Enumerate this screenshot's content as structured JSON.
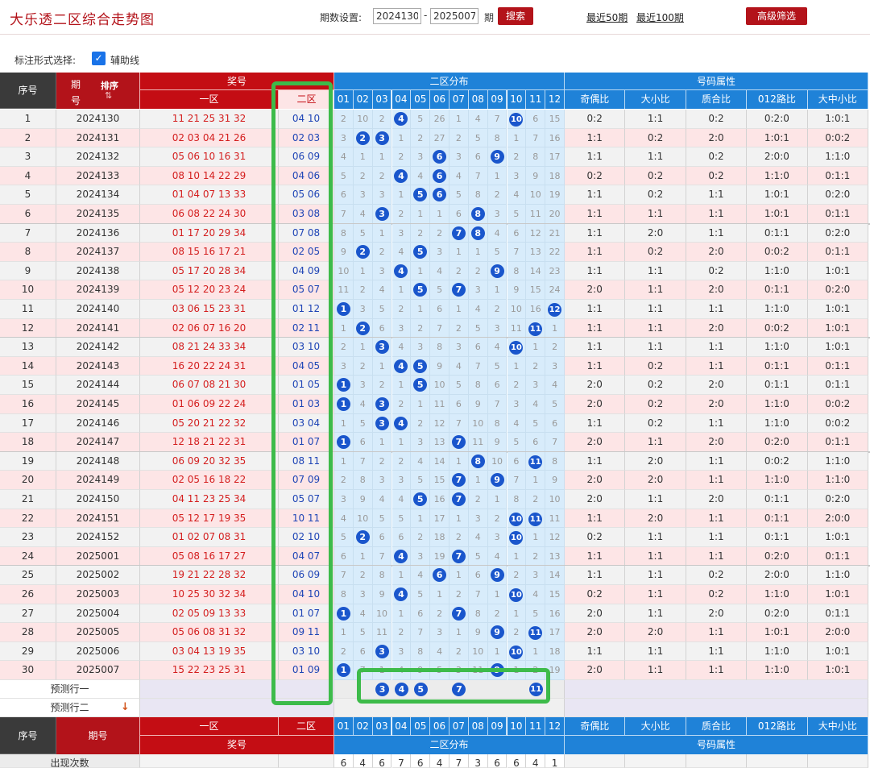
{
  "header": {
    "title": "大乐透二区综合走势图",
    "period_label": "期数设置:",
    "period_start": "2024130",
    "period_end": "2025007",
    "period_unit": "期",
    "search_label": "搜索",
    "recent50_label": "最近50期",
    "recent100_label": "最近100期",
    "advanced_label": "高级筛选"
  },
  "marking": {
    "label": "标注形式选择:",
    "guide_label": "辅助线"
  },
  "table_header": {
    "seq": "序号",
    "issue_top": "期",
    "issue_bottom": "号",
    "sort": "排序",
    "award": "奖号",
    "zone1": "一区",
    "zone2": "二区",
    "dist": "二区分布",
    "attr": "号码属性",
    "attr_cols": [
      "奇偶比",
      "大小比",
      "质合比",
      "012路比",
      "大中小比"
    ],
    "nums": [
      "01",
      "02",
      "03",
      "04",
      "05",
      "06",
      "07",
      "08",
      "09",
      "10",
      "11",
      "12"
    ]
  },
  "rows": [
    {
      "seq": "1",
      "issue": "2024130",
      "front": "11 21 25 31 32",
      "back": "04 10",
      "dist": [
        "2",
        "10",
        "2",
        "4",
        "5",
        "26",
        "1",
        "4",
        "7",
        "10",
        "6",
        "15"
      ],
      "attrs": [
        "0:2",
        "1:1",
        "0:2",
        "0:2:0",
        "1:0:1"
      ]
    },
    {
      "seq": "2",
      "issue": "2024131",
      "front": "02 03 04 21 26",
      "back": "02 03",
      "dist": [
        "3",
        "2",
        "3",
        "1",
        "2",
        "27",
        "2",
        "5",
        "8",
        "1",
        "7",
        "16"
      ],
      "attrs": [
        "1:1",
        "0:2",
        "2:0",
        "1:0:1",
        "0:0:2"
      ]
    },
    {
      "seq": "3",
      "issue": "2024132",
      "front": "05 06 10 16 31",
      "back": "06 09",
      "dist": [
        "4",
        "1",
        "1",
        "2",
        "3",
        "6",
        "3",
        "6",
        "9",
        "2",
        "8",
        "17"
      ],
      "attrs": [
        "1:1",
        "1:1",
        "0:2",
        "2:0:0",
        "1:1:0"
      ]
    },
    {
      "seq": "4",
      "issue": "2024133",
      "front": "08 10 14 22 29",
      "back": "04 06",
      "dist": [
        "5",
        "2",
        "2",
        "4",
        "4",
        "6",
        "4",
        "7",
        "1",
        "3",
        "9",
        "18"
      ],
      "attrs": [
        "0:2",
        "0:2",
        "0:2",
        "1:1:0",
        "0:1:1"
      ]
    },
    {
      "seq": "5",
      "issue": "2024134",
      "front": "01 04 07 13 33",
      "back": "05 06",
      "dist": [
        "6",
        "3",
        "3",
        "1",
        "5",
        "6",
        "5",
        "8",
        "2",
        "4",
        "10",
        "19"
      ],
      "attrs": [
        "1:1",
        "0:2",
        "1:1",
        "1:0:1",
        "0:2:0"
      ]
    },
    {
      "seq": "6",
      "issue": "2024135",
      "front": "06 08 22 24 30",
      "back": "03 08",
      "dist": [
        "7",
        "4",
        "3",
        "2",
        "1",
        "1",
        "6",
        "8",
        "3",
        "5",
        "11",
        "20"
      ],
      "attrs": [
        "1:1",
        "1:1",
        "1:1",
        "1:0:1",
        "0:1:1"
      ]
    },
    {
      "seq": "7",
      "issue": "2024136",
      "front": "01 17 20 29 34",
      "back": "07 08",
      "dist": [
        "8",
        "5",
        "1",
        "3",
        "2",
        "2",
        "7",
        "8",
        "4",
        "6",
        "12",
        "21"
      ],
      "attrs": [
        "1:1",
        "2:0",
        "1:1",
        "0:1:1",
        "0:2:0"
      ]
    },
    {
      "seq": "8",
      "issue": "2024137",
      "front": "08 15 16 17 21",
      "back": "02 05",
      "dist": [
        "9",
        "2",
        "2",
        "4",
        "5",
        "3",
        "1",
        "1",
        "5",
        "7",
        "13",
        "22"
      ],
      "attrs": [
        "1:1",
        "0:2",
        "2:0",
        "0:0:2",
        "0:1:1"
      ]
    },
    {
      "seq": "9",
      "issue": "2024138",
      "front": "05 17 20 28 34",
      "back": "04 09",
      "dist": [
        "10",
        "1",
        "3",
        "4",
        "1",
        "4",
        "2",
        "2",
        "9",
        "8",
        "14",
        "23"
      ],
      "attrs": [
        "1:1",
        "1:1",
        "0:2",
        "1:1:0",
        "1:0:1"
      ]
    },
    {
      "seq": "10",
      "issue": "2024139",
      "front": "05 12 20 23 24",
      "back": "05 07",
      "dist": [
        "11",
        "2",
        "4",
        "1",
        "5",
        "5",
        "7",
        "3",
        "1",
        "9",
        "15",
        "24"
      ],
      "attrs": [
        "2:0",
        "1:1",
        "2:0",
        "0:1:1",
        "0:2:0"
      ]
    },
    {
      "seq": "11",
      "issue": "2024140",
      "front": "03 06 15 23 31",
      "back": "01 12",
      "dist": [
        "1",
        "3",
        "5",
        "2",
        "1",
        "6",
        "1",
        "4",
        "2",
        "10",
        "16",
        "12"
      ],
      "attrs": [
        "1:1",
        "1:1",
        "1:1",
        "1:1:0",
        "1:0:1"
      ]
    },
    {
      "seq": "12",
      "issue": "2024141",
      "front": "02 06 07 16 20",
      "back": "02 11",
      "dist": [
        "1",
        "2",
        "6",
        "3",
        "2",
        "7",
        "2",
        "5",
        "3",
        "11",
        "11",
        "1"
      ],
      "attrs": [
        "1:1",
        "1:1",
        "2:0",
        "0:0:2",
        "1:0:1"
      ]
    },
    {
      "seq": "13",
      "issue": "2024142",
      "front": "08 21 24 33 34",
      "back": "03 10",
      "dist": [
        "2",
        "1",
        "3",
        "4",
        "3",
        "8",
        "3",
        "6",
        "4",
        "10",
        "1",
        "2"
      ],
      "attrs": [
        "1:1",
        "1:1",
        "1:1",
        "1:1:0",
        "1:0:1"
      ]
    },
    {
      "seq": "14",
      "issue": "2024143",
      "front": "16 20 22 24 31",
      "back": "04 05",
      "dist": [
        "3",
        "2",
        "1",
        "4",
        "5",
        "9",
        "4",
        "7",
        "5",
        "1",
        "2",
        "3"
      ],
      "attrs": [
        "1:1",
        "0:2",
        "1:1",
        "0:1:1",
        "0:1:1"
      ]
    },
    {
      "seq": "15",
      "issue": "2024144",
      "front": "06 07 08 21 30",
      "back": "01 05",
      "dist": [
        "1",
        "3",
        "2",
        "1",
        "5",
        "10",
        "5",
        "8",
        "6",
        "2",
        "3",
        "4"
      ],
      "attrs": [
        "2:0",
        "0:2",
        "2:0",
        "0:1:1",
        "0:1:1"
      ]
    },
    {
      "seq": "16",
      "issue": "2024145",
      "front": "01 06 09 22 24",
      "back": "01 03",
      "dist": [
        "1",
        "4",
        "3",
        "2",
        "1",
        "11",
        "6",
        "9",
        "7",
        "3",
        "4",
        "5"
      ],
      "attrs": [
        "2:0",
        "0:2",
        "2:0",
        "1:1:0",
        "0:0:2"
      ]
    },
    {
      "seq": "17",
      "issue": "2024146",
      "front": "05 20 21 22 32",
      "back": "03 04",
      "dist": [
        "1",
        "5",
        "3",
        "4",
        "2",
        "12",
        "7",
        "10",
        "8",
        "4",
        "5",
        "6"
      ],
      "attrs": [
        "1:1",
        "0:2",
        "1:1",
        "1:1:0",
        "0:0:2"
      ]
    },
    {
      "seq": "18",
      "issue": "2024147",
      "front": "12 18 21 22 31",
      "back": "01 07",
      "dist": [
        "1",
        "6",
        "1",
        "1",
        "3",
        "13",
        "7",
        "11",
        "9",
        "5",
        "6",
        "7"
      ],
      "attrs": [
        "2:0",
        "1:1",
        "2:0",
        "0:2:0",
        "0:1:1"
      ]
    },
    {
      "seq": "19",
      "issue": "2024148",
      "front": "06 09 20 32 35",
      "back": "08 11",
      "dist": [
        "1",
        "7",
        "2",
        "2",
        "4",
        "14",
        "1",
        "8",
        "10",
        "6",
        "11",
        "8"
      ],
      "attrs": [
        "1:1",
        "2:0",
        "1:1",
        "0:0:2",
        "1:1:0"
      ]
    },
    {
      "seq": "20",
      "issue": "2024149",
      "front": "02 05 16 18 22",
      "back": "07 09",
      "dist": [
        "2",
        "8",
        "3",
        "3",
        "5",
        "15",
        "7",
        "1",
        "9",
        "7",
        "1",
        "9"
      ],
      "attrs": [
        "2:0",
        "2:0",
        "1:1",
        "1:1:0",
        "1:1:0"
      ]
    },
    {
      "seq": "21",
      "issue": "2024150",
      "front": "04 11 23 25 34",
      "back": "05 07",
      "dist": [
        "3",
        "9",
        "4",
        "4",
        "5",
        "16",
        "7",
        "2",
        "1",
        "8",
        "2",
        "10"
      ],
      "attrs": [
        "2:0",
        "1:1",
        "2:0",
        "0:1:1",
        "0:2:0"
      ]
    },
    {
      "seq": "22",
      "issue": "2024151",
      "front": "05 12 17 19 35",
      "back": "10 11",
      "dist": [
        "4",
        "10",
        "5",
        "5",
        "1",
        "17",
        "1",
        "3",
        "2",
        "10",
        "11",
        "11"
      ],
      "attrs": [
        "1:1",
        "2:0",
        "1:1",
        "0:1:1",
        "2:0:0"
      ]
    },
    {
      "seq": "23",
      "issue": "2024152",
      "front": "01 02 07 08 31",
      "back": "02 10",
      "dist": [
        "5",
        "2",
        "6",
        "6",
        "2",
        "18",
        "2",
        "4",
        "3",
        "10",
        "1",
        "12"
      ],
      "attrs": [
        "0:2",
        "1:1",
        "1:1",
        "0:1:1",
        "1:0:1"
      ]
    },
    {
      "seq": "24",
      "issue": "2025001",
      "front": "05 08 16 17 27",
      "back": "04 07",
      "dist": [
        "6",
        "1",
        "7",
        "4",
        "3",
        "19",
        "7",
        "5",
        "4",
        "1",
        "2",
        "13"
      ],
      "attrs": [
        "1:1",
        "1:1",
        "1:1",
        "0:2:0",
        "0:1:1"
      ]
    },
    {
      "seq": "25",
      "issue": "2025002",
      "front": "19 21 22 28 32",
      "back": "06 09",
      "dist": [
        "7",
        "2",
        "8",
        "1",
        "4",
        "6",
        "1",
        "6",
        "9",
        "2",
        "3",
        "14"
      ],
      "attrs": [
        "1:1",
        "1:1",
        "0:2",
        "2:0:0",
        "1:1:0"
      ]
    },
    {
      "seq": "26",
      "issue": "2025003",
      "front": "10 25 30 32 34",
      "back": "04 10",
      "dist": [
        "8",
        "3",
        "9",
        "4",
        "5",
        "1",
        "2",
        "7",
        "1",
        "10",
        "4",
        "15"
      ],
      "attrs": [
        "0:2",
        "1:1",
        "0:2",
        "1:1:0",
        "1:0:1"
      ]
    },
    {
      "seq": "27",
      "issue": "2025004",
      "front": "02 05 09 13 33",
      "back": "01 07",
      "dist": [
        "1",
        "4",
        "10",
        "1",
        "6",
        "2",
        "7",
        "8",
        "2",
        "1",
        "5",
        "16"
      ],
      "attrs": [
        "2:0",
        "1:1",
        "2:0",
        "0:2:0",
        "0:1:1"
      ]
    },
    {
      "seq": "28",
      "issue": "2025005",
      "front": "05 06 08 31 32",
      "back": "09 11",
      "dist": [
        "1",
        "5",
        "11",
        "2",
        "7",
        "3",
        "1",
        "9",
        "9",
        "2",
        "11",
        "17"
      ],
      "attrs": [
        "2:0",
        "2:0",
        "1:1",
        "1:0:1",
        "2:0:0"
      ]
    },
    {
      "seq": "29",
      "issue": "2025006",
      "front": "03 04 13 19 35",
      "back": "03 10",
      "dist": [
        "2",
        "6",
        "3",
        "3",
        "8",
        "4",
        "2",
        "10",
        "1",
        "10",
        "1",
        "18"
      ],
      "attrs": [
        "1:1",
        "1:1",
        "1:1",
        "1:1:0",
        "1:0:1"
      ]
    },
    {
      "seq": "30",
      "issue": "2025007",
      "front": "15 22 23 25 31",
      "back": "01 09",
      "dist": [
        "1",
        "7",
        "1",
        "4",
        "9",
        "5",
        "3",
        "11",
        "9",
        "1",
        "2",
        "19"
      ],
      "attrs": [
        "2:0",
        "1:1",
        "1:1",
        "1:1:0",
        "1:0:1"
      ]
    }
  ],
  "hit_pairs": [
    [
      "04",
      "10"
    ],
    [
      "02",
      "03"
    ],
    [
      "06",
      "09"
    ],
    [
      "04",
      "06"
    ],
    [
      "05",
      "06"
    ],
    [
      "03",
      "08"
    ],
    [
      "07",
      "08"
    ],
    [
      "02",
      "05"
    ],
    [
      "04",
      "09"
    ],
    [
      "05",
      "07"
    ],
    [
      "01",
      "12"
    ],
    [
      "02",
      "11"
    ],
    [
      "03",
      "10"
    ],
    [
      "04",
      "05"
    ],
    [
      "01",
      "05"
    ],
    [
      "01",
      "03"
    ],
    [
      "03",
      "04"
    ],
    [
      "01",
      "07"
    ],
    [
      "08",
      "11"
    ],
    [
      "07",
      "09"
    ],
    [
      "05",
      "07"
    ],
    [
      "10",
      "11"
    ],
    [
      "02",
      "10"
    ],
    [
      "04",
      "07"
    ],
    [
      "06",
      "09"
    ],
    [
      "04",
      "10"
    ],
    [
      "01",
      "07"
    ],
    [
      "09",
      "11"
    ],
    [
      "03",
      "10"
    ],
    [
      "01",
      "09"
    ]
  ],
  "predict": {
    "row1_label": "预测行一",
    "row2_label": "预测行二",
    "balls": [
      "3",
      "4",
      "5",
      "7",
      "11"
    ]
  },
  "footer": {
    "seq": "序号",
    "issue": "期号",
    "zone1": "一区",
    "zone2": "二区",
    "award": "奖号",
    "dist": "二区分布",
    "attr": "号码属性",
    "count_label": "出现次数",
    "counts": [
      "6",
      "4",
      "6",
      "7",
      "6",
      "4",
      "7",
      "3",
      "6",
      "6",
      "4",
      "1"
    ]
  }
}
